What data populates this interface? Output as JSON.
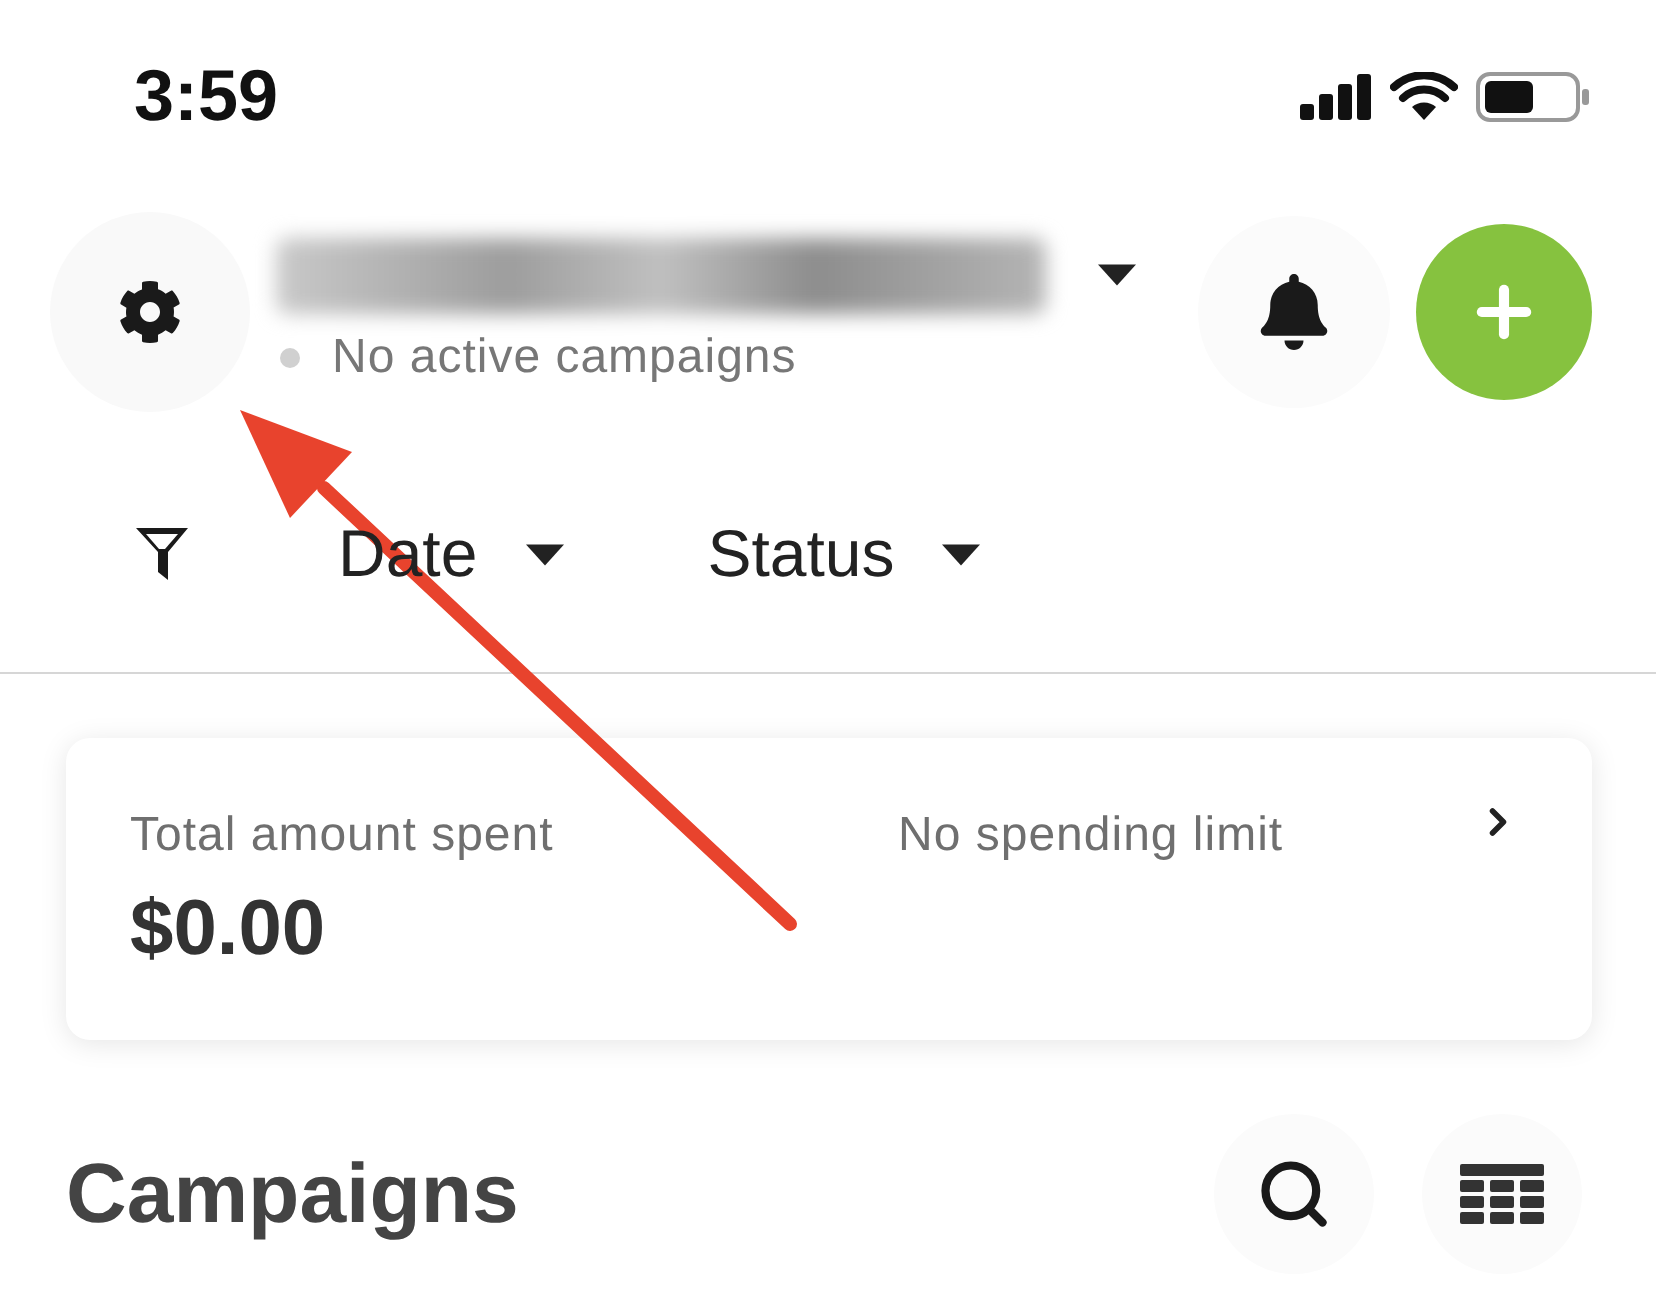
{
  "status_bar": {
    "time": "3:59"
  },
  "header": {
    "account": {
      "status": {
        "label": "No active campaigns",
        "active": false
      }
    }
  },
  "filters": [
    {
      "label": "Date"
    },
    {
      "label": "Status"
    }
  ],
  "summary_card": {
    "spent_label": "Total amount spent",
    "spent_value": "$0.00",
    "limit_label": "No spending limit"
  },
  "section": {
    "title": "Campaigns"
  }
}
